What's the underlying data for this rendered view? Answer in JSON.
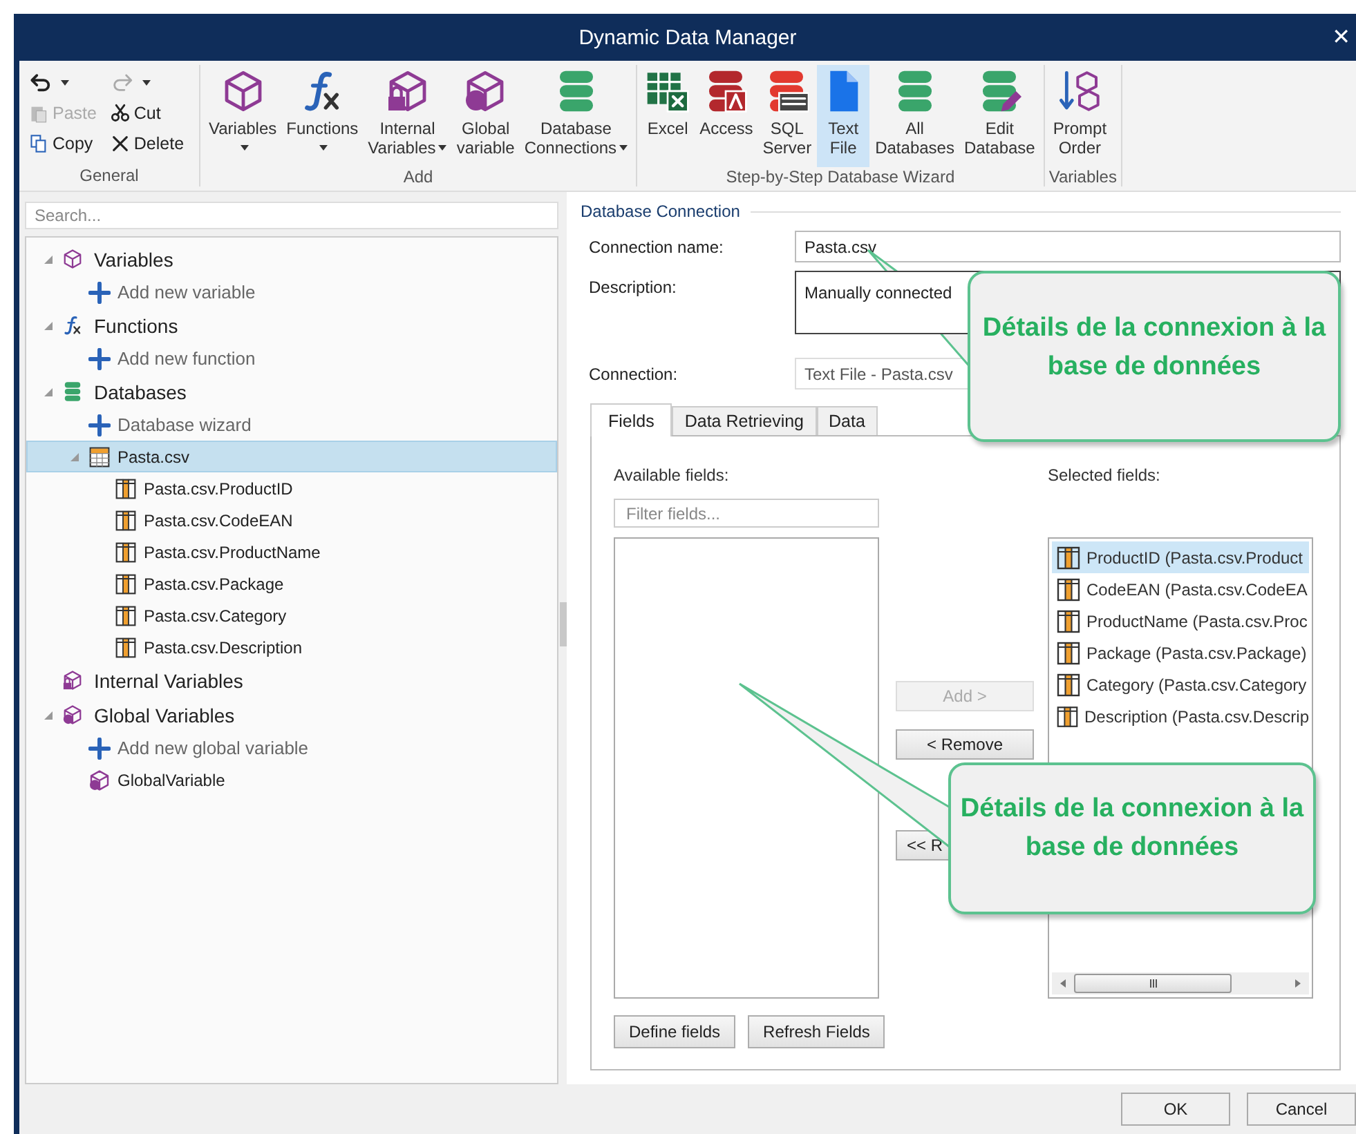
{
  "window": {
    "title": "Dynamic Data Manager",
    "close": "✕"
  },
  "ribbon": {
    "groups": [
      {
        "label": "General",
        "kind": "small",
        "items": [
          {
            "kind": "undo",
            "disabled": false,
            "dropdown": true
          },
          {
            "kind": "redo",
            "disabled": true,
            "dropdown": true
          },
          {
            "kind": "paste",
            "label": "Paste",
            "disabled": true
          },
          {
            "kind": "cut",
            "label": "Cut",
            "disabled": false
          },
          {
            "kind": "copy",
            "label": "Copy",
            "disabled": false
          },
          {
            "kind": "delete",
            "label": "Delete",
            "disabled": false
          }
        ]
      },
      {
        "label": "Add",
        "kind": "large",
        "items": [
          {
            "kind": "variables",
            "lines": [
              "Variables"
            ],
            "dropdown": true,
            "selected": false
          },
          {
            "kind": "functions",
            "lines": [
              "Functions"
            ],
            "dropdown": true,
            "selected": false
          },
          {
            "kind": "internal",
            "lines": [
              "Internal",
              "Variables"
            ],
            "dropdown": true,
            "selected": false
          },
          {
            "kind": "global",
            "lines": [
              "Global",
              "variable"
            ],
            "dropdown": false,
            "selected": false
          },
          {
            "kind": "database",
            "lines": [
              "Database",
              "Connections"
            ],
            "dropdown": true,
            "selected": false
          }
        ]
      },
      {
        "label": "Step-by-Step Database Wizard",
        "kind": "large",
        "items": [
          {
            "kind": "excel",
            "lines": [
              "Excel"
            ],
            "dropdown": false,
            "selected": false
          },
          {
            "kind": "access",
            "lines": [
              "Access"
            ],
            "dropdown": false,
            "selected": false
          },
          {
            "kind": "sql",
            "lines": [
              "SQL",
              "Server"
            ],
            "dropdown": false,
            "selected": false
          },
          {
            "kind": "textfile",
            "lines": [
              "Text",
              "File"
            ],
            "dropdown": false,
            "selected": true
          },
          {
            "kind": "database",
            "lines": [
              "All",
              "Databases"
            ],
            "dropdown": false,
            "selected": false
          },
          {
            "kind": "editdb",
            "lines": [
              "Edit",
              "Database"
            ],
            "dropdown": false,
            "selected": false
          }
        ]
      },
      {
        "label": "Variables",
        "kind": "large",
        "items": [
          {
            "kind": "prompt",
            "lines": [
              "Prompt",
              "Order"
            ],
            "dropdown": false,
            "selected": false
          }
        ]
      }
    ]
  },
  "search": {
    "placeholder": "Search..."
  },
  "tree": [
    {
      "label": "Variables",
      "kind": "variables",
      "expanded": true,
      "selected": false,
      "children": [
        {
          "label": "Add new variable",
          "kind": "add",
          "selected": false
        }
      ]
    },
    {
      "label": "Functions",
      "kind": "functions",
      "expanded": true,
      "selected": false,
      "children": [
        {
          "label": "Add new function",
          "kind": "add",
          "selected": false
        }
      ]
    },
    {
      "label": "Databases",
      "kind": "database",
      "expanded": true,
      "selected": false,
      "children": [
        {
          "label": "Database wizard",
          "kind": "add",
          "selected": false
        },
        {
          "label": "Pasta.csv",
          "kind": "table",
          "expanded": true,
          "selected": true,
          "children": [
            {
              "label": "Pasta.csv.ProductID",
              "kind": "field",
              "selected": false
            },
            {
              "label": "Pasta.csv.CodeEAN",
              "kind": "field",
              "selected": false
            },
            {
              "label": "Pasta.csv.ProductName",
              "kind": "field",
              "selected": false
            },
            {
              "label": "Pasta.csv.Package",
              "kind": "field",
              "selected": false
            },
            {
              "label": "Pasta.csv.Category",
              "kind": "field",
              "selected": false
            },
            {
              "label": "Pasta.csv.Description",
              "kind": "field",
              "selected": false
            }
          ]
        }
      ]
    },
    {
      "label": "Internal Variables",
      "kind": "internal",
      "selected": false
    },
    {
      "label": "Global Variables",
      "kind": "global",
      "expanded": true,
      "selected": false,
      "children": [
        {
          "label": "Add new global variable",
          "kind": "add",
          "selected": false
        },
        {
          "label": "GlobalVariable",
          "kind": "global",
          "selected": false
        }
      ]
    }
  ],
  "connection": {
    "group_title": "Database Connection",
    "name_label": "Connection name:",
    "name_value": "Pasta.csv",
    "description_label": "Description:",
    "description_value": "Manually connected",
    "connection_label": "Connection:",
    "connection_value": "Text File - Pasta.csv"
  },
  "tabs": [
    {
      "label": "Fields",
      "selected": true
    },
    {
      "label": "Data Retrieving",
      "selected": false
    },
    {
      "label": "Data",
      "selected": false
    }
  ],
  "fields_panel": {
    "available_label": "Available fields:",
    "filter_placeholder": "Filter fields...",
    "selected_label": "Selected fields:",
    "selected_fields": [
      {
        "label": "ProductID (Pasta.csv.Product",
        "selected": true
      },
      {
        "label": "CodeEAN (Pasta.csv.CodeEA",
        "selected": false
      },
      {
        "label": "ProductName (Pasta.csv.Proc",
        "selected": false
      },
      {
        "label": "Package (Pasta.csv.Package)",
        "selected": false
      },
      {
        "label": "Category (Pasta.csv.Category",
        "selected": false
      },
      {
        "label": "Description (Pasta.csv.Descrip",
        "selected": false
      }
    ],
    "move_buttons": [
      {
        "label": "Add >",
        "disabled": true
      },
      {
        "label": "< Remove",
        "disabled": false
      },
      {
        "label": "<< R",
        "disabled": false
      }
    ],
    "bottom_buttons": [
      "Define fields",
      "Refresh Fields"
    ]
  },
  "callouts": [
    "Détails de la connexion à la base de données",
    "Détails de la connexion à la base de données"
  ],
  "footer_buttons": [
    "OK",
    "Cancel"
  ]
}
